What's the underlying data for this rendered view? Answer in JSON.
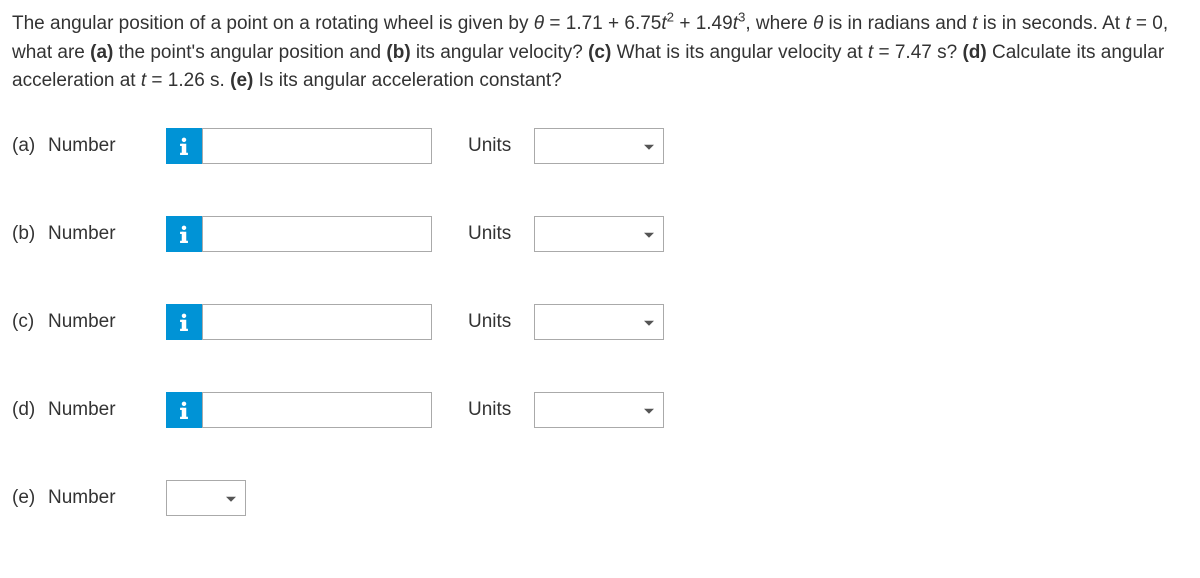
{
  "question": {
    "prefix": "The angular position of a point on a rotating wheel is given by ",
    "equation_theta": "θ",
    "equation_eq": " = 1.71 + 6.75",
    "equation_t1": "t",
    "equation_exp1": "2",
    "equation_plus": " + 1.49",
    "equation_t2": "t",
    "equation_exp2": "3",
    "equation_where": ", where ",
    "equation_theta2": "θ",
    "equation_units": " is in radians and ",
    "equation_t3": "t",
    "equation_time": " is in seconds. At ",
    "equation_t4": "t",
    "equation_zero": " = 0, what are ",
    "part_a_lbl": "(a)",
    "part_a_text": " the point's angular position and ",
    "part_b_lbl": "(b)",
    "part_b_text": " its angular velocity? ",
    "part_c_lbl": "(c)",
    "part_c_text": " What is its angular velocity at ",
    "equation_t5": "t",
    "equation_c_val": " = 7.47 s? ",
    "part_d_lbl": "(d)",
    "part_d_text": " Calculate its angular acceleration at ",
    "equation_t6": "t",
    "equation_d_val": " = 1.26 s. ",
    "part_e_lbl": "(e)",
    "part_e_text": " Is its angular acceleration constant?"
  },
  "rows": {
    "a": {
      "part": "(a)",
      "label": "Number",
      "units_label": "Units"
    },
    "b": {
      "part": "(b)",
      "label": "Number",
      "units_label": "Units"
    },
    "c": {
      "part": "(c)",
      "label": "Number",
      "units_label": "Units"
    },
    "d": {
      "part": "(d)",
      "label": "Number",
      "units_label": "Units"
    },
    "e": {
      "part": "(e)",
      "label": "Number"
    }
  }
}
